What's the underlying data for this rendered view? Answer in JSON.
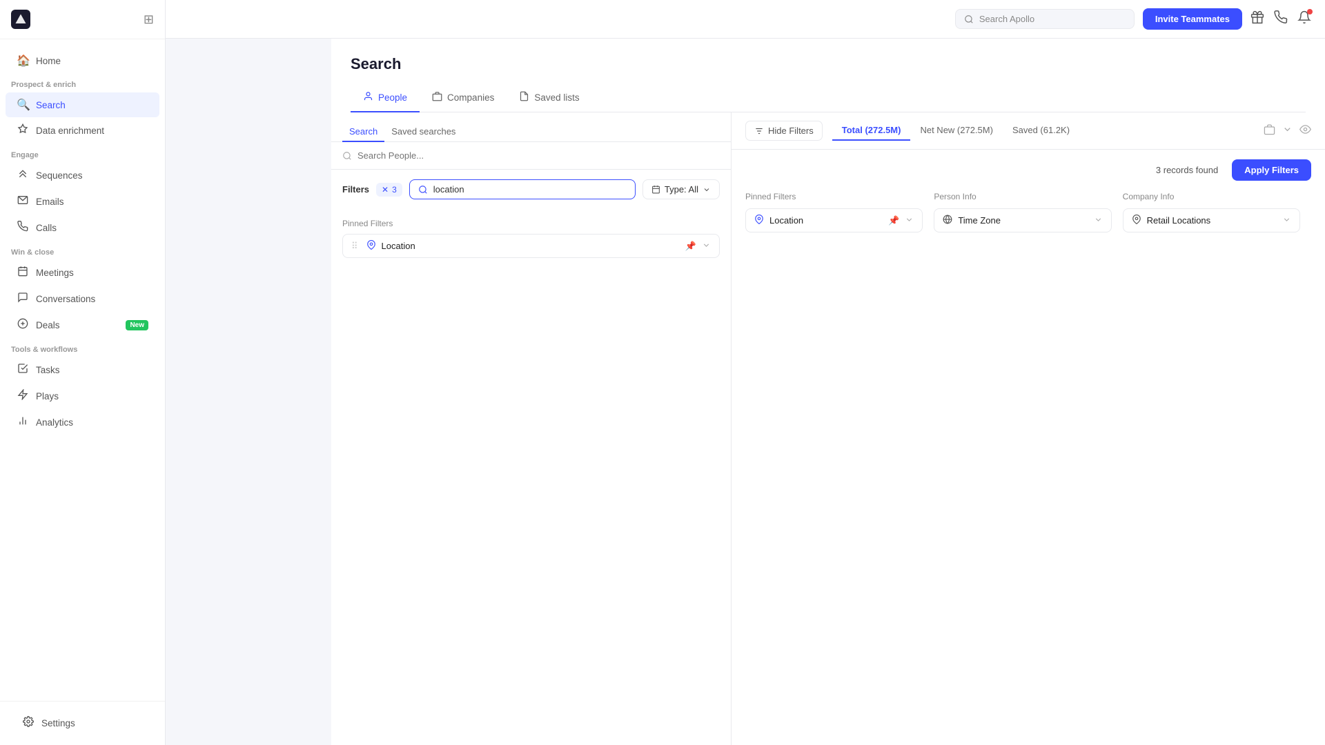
{
  "sidebar": {
    "logo": "A",
    "sections": [
      {
        "label": "",
        "items": [
          {
            "id": "home",
            "icon": "🏠",
            "label": "Home",
            "active": false
          }
        ]
      },
      {
        "label": "Prospect & enrich",
        "items": [
          {
            "id": "search",
            "icon": "🔍",
            "label": "Search",
            "active": true
          },
          {
            "id": "data-enrichment",
            "icon": "⬆",
            "label": "Data enrichment",
            "active": false
          }
        ]
      },
      {
        "label": "Engage",
        "items": [
          {
            "id": "sequences",
            "icon": "≫",
            "label": "Sequences",
            "active": false
          },
          {
            "id": "emails",
            "icon": "✉",
            "label": "Emails",
            "active": false
          },
          {
            "id": "calls",
            "icon": "📞",
            "label": "Calls",
            "active": false
          }
        ]
      },
      {
        "label": "Win & close",
        "items": [
          {
            "id": "meetings",
            "icon": "📅",
            "label": "Meetings",
            "active": false
          },
          {
            "id": "conversations",
            "icon": "💬",
            "label": "Conversations",
            "active": false
          },
          {
            "id": "deals",
            "icon": "💲",
            "label": "Deals",
            "active": false,
            "badge": "New"
          }
        ]
      },
      {
        "label": "Tools & workflows",
        "items": [
          {
            "id": "tasks",
            "icon": "✔",
            "label": "Tasks",
            "active": false
          },
          {
            "id": "plays",
            "icon": "⚡",
            "label": "Plays",
            "active": false
          },
          {
            "id": "analytics",
            "icon": "📊",
            "label": "Analytics",
            "active": false
          }
        ]
      }
    ],
    "footer": [
      {
        "id": "settings",
        "icon": "⚙",
        "label": "Settings",
        "active": false
      }
    ]
  },
  "topbar": {
    "search_placeholder": "Search Apollo",
    "invite_button": "Invite Teammates"
  },
  "page": {
    "title": "Search",
    "tabs": [
      {
        "id": "people",
        "icon": "👤",
        "label": "People",
        "active": true
      },
      {
        "id": "companies",
        "icon": "🏢",
        "label": "Companies",
        "active": false
      },
      {
        "id": "saved-lists",
        "icon": "📄",
        "label": "Saved lists",
        "active": false
      }
    ]
  },
  "left_panel": {
    "sub_tabs": [
      {
        "id": "search",
        "label": "Search",
        "active": true
      },
      {
        "id": "saved-searches",
        "label": "Saved searches",
        "active": false
      }
    ],
    "search_placeholder": "Search People...",
    "filters": {
      "label": "Filters",
      "count": "3",
      "search_value": "location",
      "type_label": "Type: All",
      "sections": [
        {
          "title": "Pinned Filters",
          "items": [
            {
              "id": "location",
              "icon": "📍",
              "label": "Location",
              "pin": "📌",
              "pinned": true
            }
          ]
        }
      ]
    }
  },
  "right_panel": {
    "hide_filters_label": "Hide Filters",
    "tabs": [
      {
        "id": "total",
        "label": "Total (272.5M)",
        "active": true
      },
      {
        "id": "net-new",
        "label": "Net New (272.5M)",
        "active": false
      },
      {
        "id": "saved",
        "label": "Saved (61.2K)",
        "active": false
      }
    ],
    "records_found": "3 records found",
    "apply_filters_btn": "Apply Filters",
    "filter_columns": [
      {
        "title": "Pinned Filters",
        "items": [
          {
            "id": "location",
            "icon": "📍",
            "label": "Location",
            "has_pin": true
          }
        ]
      },
      {
        "title": "Person Info",
        "items": [
          {
            "id": "timezone",
            "icon": "🌐",
            "label": "Time Zone"
          }
        ]
      },
      {
        "title": "Company Info",
        "items": [
          {
            "id": "retail-locations",
            "icon": "📍",
            "label": "Retail Locations"
          }
        ]
      }
    ]
  }
}
